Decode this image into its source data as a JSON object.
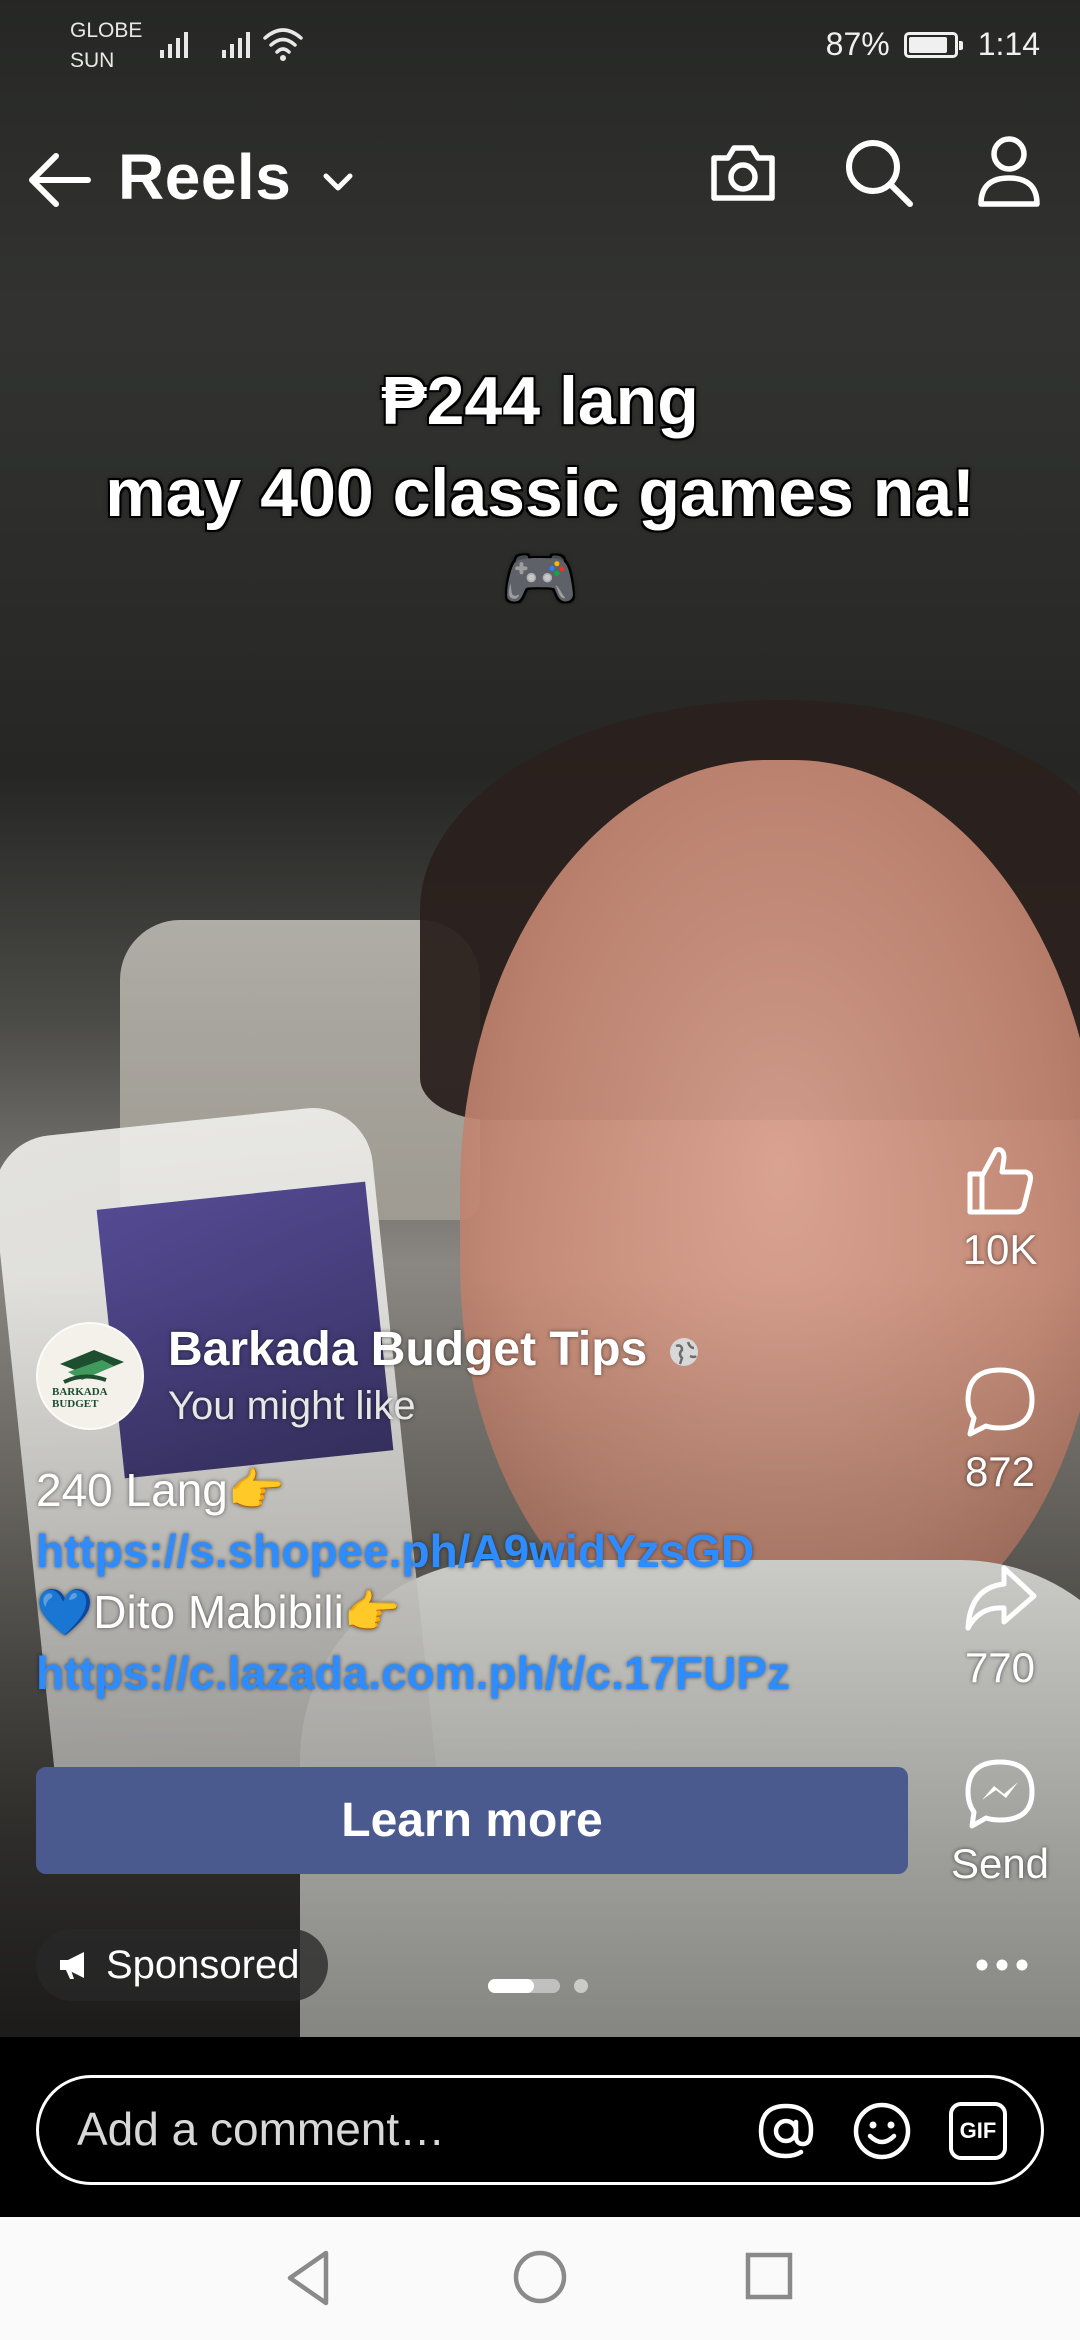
{
  "status_bar": {
    "carrier_1": "GLOBE",
    "carrier_2": "SUN",
    "battery_percent": "87%",
    "battery_level": 0.87,
    "time": "1:14"
  },
  "header": {
    "title": "Reels",
    "icons": [
      "back-arrow-icon",
      "chevron-down-icon",
      "camera-icon",
      "search-icon",
      "profile-icon"
    ]
  },
  "video": {
    "caption_line_1": "₱244 lang",
    "caption_line_2": "may 400 classic games na!",
    "caption_emoji": "🎮"
  },
  "actions": {
    "like_count": "10K",
    "comment_count": "872",
    "share_count": "770",
    "send_label": "Send"
  },
  "author": {
    "page_name": "Barkada Budget Tips",
    "suggestion_text": "You might like",
    "avatar_text": "BARKADA BUDGET"
  },
  "description": {
    "line_1": "240 Lang👉",
    "link_1": "https://s.shopee.ph/A9widYzsGD",
    "line_2": "💙Dito Mabibili👉",
    "link_2": "https://c.lazada.com.ph/t/c.17FUPz"
  },
  "cta": {
    "label": "Learn more",
    "color": "#4b5a8e"
  },
  "sponsored": {
    "label": "Sponsored"
  },
  "pager": {
    "pages": 2,
    "current": 1
  },
  "comment": {
    "placeholder": "Add a comment…",
    "gif_label": "GIF"
  },
  "colors": {
    "link": "#2d8cff",
    "background": "#000000",
    "nav_bar": "#fafafa"
  }
}
